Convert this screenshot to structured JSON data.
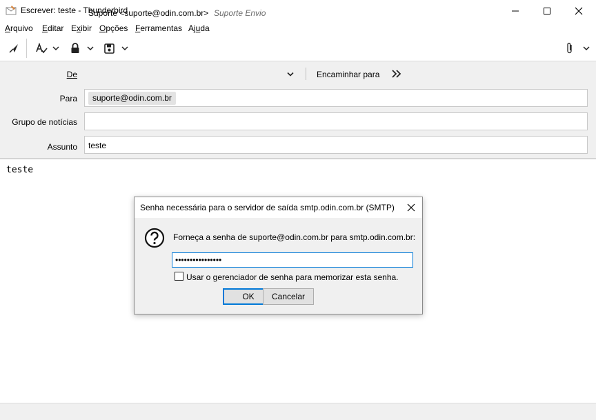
{
  "window": {
    "title": "Escrever: teste - Thunderbird"
  },
  "menu": {
    "items": [
      {
        "pre": "",
        "u": "A",
        "post": "rquivo"
      },
      {
        "pre": "",
        "u": "E",
        "post": "ditar"
      },
      {
        "pre": "E",
        "u": "x",
        "post": "ibir"
      },
      {
        "pre": "",
        "u": "O",
        "post": "pções"
      },
      {
        "pre": "",
        "u": "F",
        "post": "erramentas"
      },
      {
        "pre": "Aj",
        "u": "u",
        "post": "da"
      }
    ]
  },
  "headers": {
    "from_label": "De",
    "from_value": "Suporte <suporte@odin.com.br>",
    "from_identity": "Suporte Envio",
    "forward_label": "Encaminhar para",
    "to_label": "Para",
    "to_recipient": "suporte@odin.com.br",
    "newsgroup_label": "Grupo de notícias",
    "subject_label": "Assunto",
    "subject_value": "teste"
  },
  "body": {
    "text": "teste"
  },
  "dialog": {
    "title": "Senha necessária para o servidor de saída smtp.odin.com.br (SMTP)",
    "message": "Forneça a senha de suporte@odin.com.br para smtp.odin.com.br:",
    "password_value": "••••••••••••••••",
    "remember_label": "Usar o gerenciador de senha para memorizar esta senha.",
    "ok_label": "OK",
    "cancel_label": "Cancelar"
  }
}
